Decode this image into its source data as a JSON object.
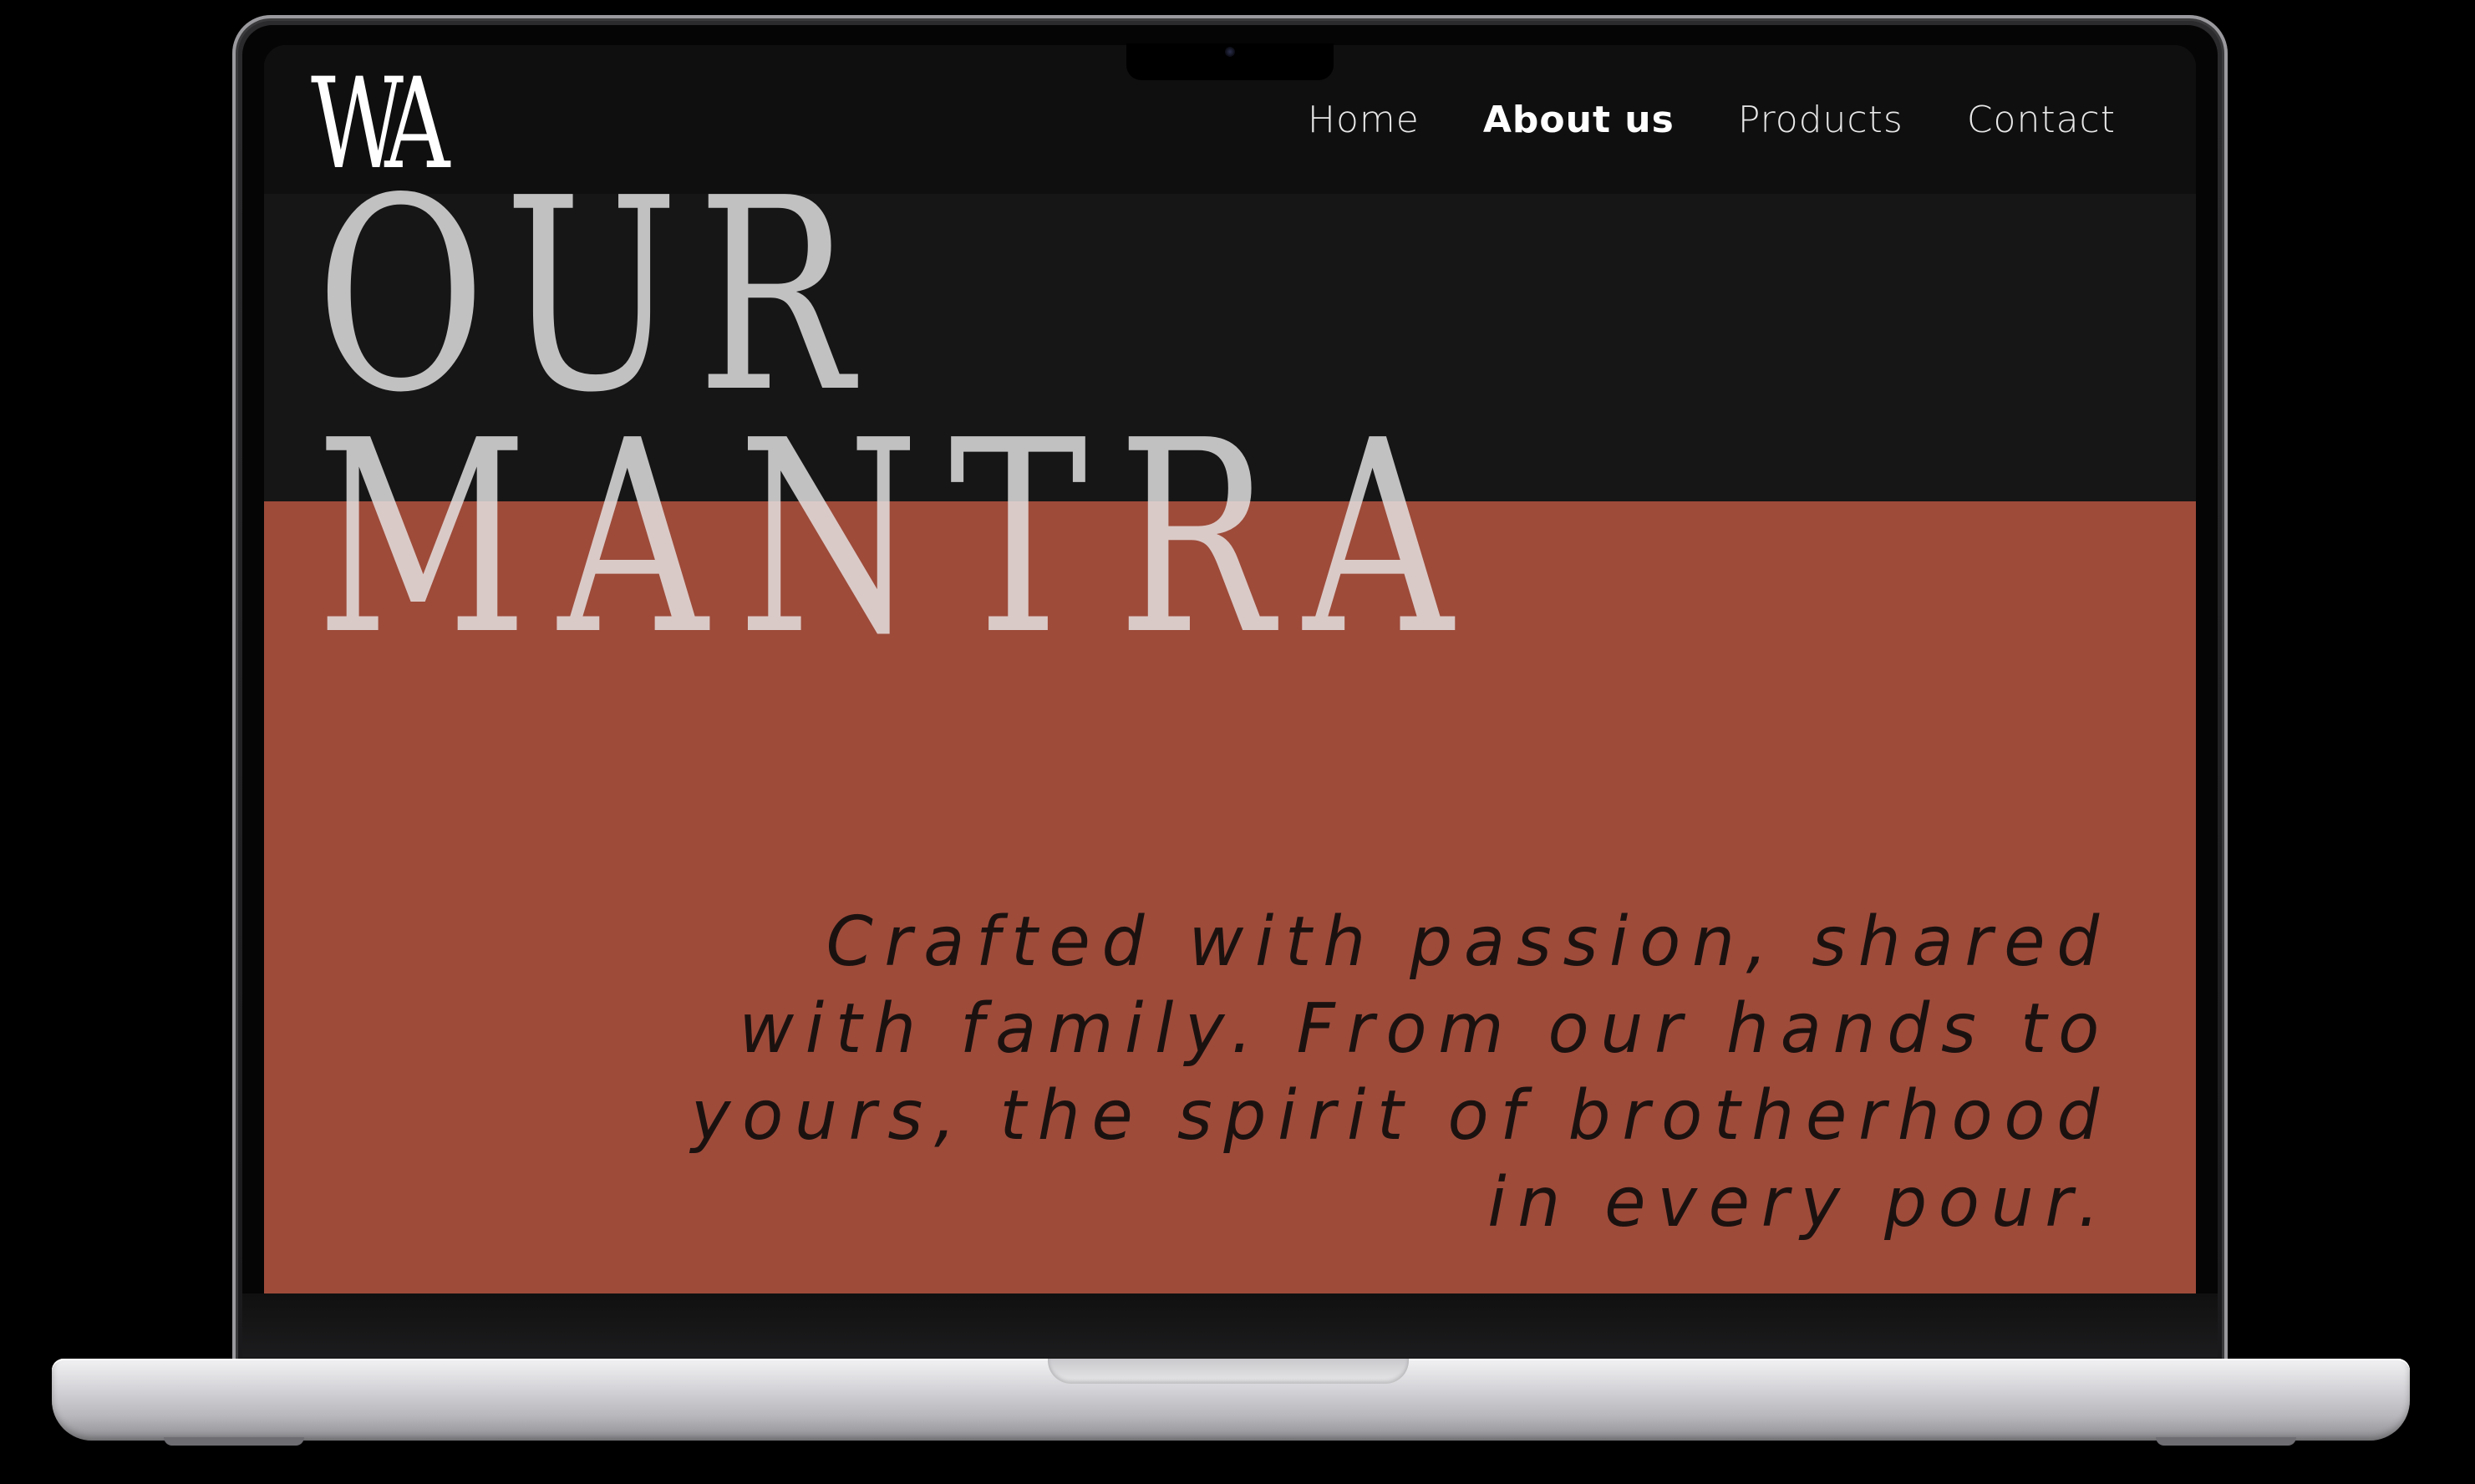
{
  "site": {
    "logo": "WA",
    "nav": {
      "items": [
        {
          "label": "Home",
          "active": false
        },
        {
          "label": "About us",
          "active": true
        },
        {
          "label": "Products",
          "active": false
        },
        {
          "label": "Contact",
          "active": false
        }
      ]
    },
    "hero": {
      "title_line_1": "OUR",
      "title_line_2": "MANTRA"
    },
    "tagline": "Crafted with passion, shared with family. From our hands to yours, the spirit of brotherhood in every pour."
  },
  "colors": {
    "background": "#000000",
    "screen_dark": "#161616",
    "accent_terracotta": "#9e4b3a",
    "nav_text": "#e8e8e8",
    "tagline_text": "#1b1210"
  },
  "device": {
    "type": "laptop-mockup",
    "camera_icon": "webcam-icon"
  }
}
